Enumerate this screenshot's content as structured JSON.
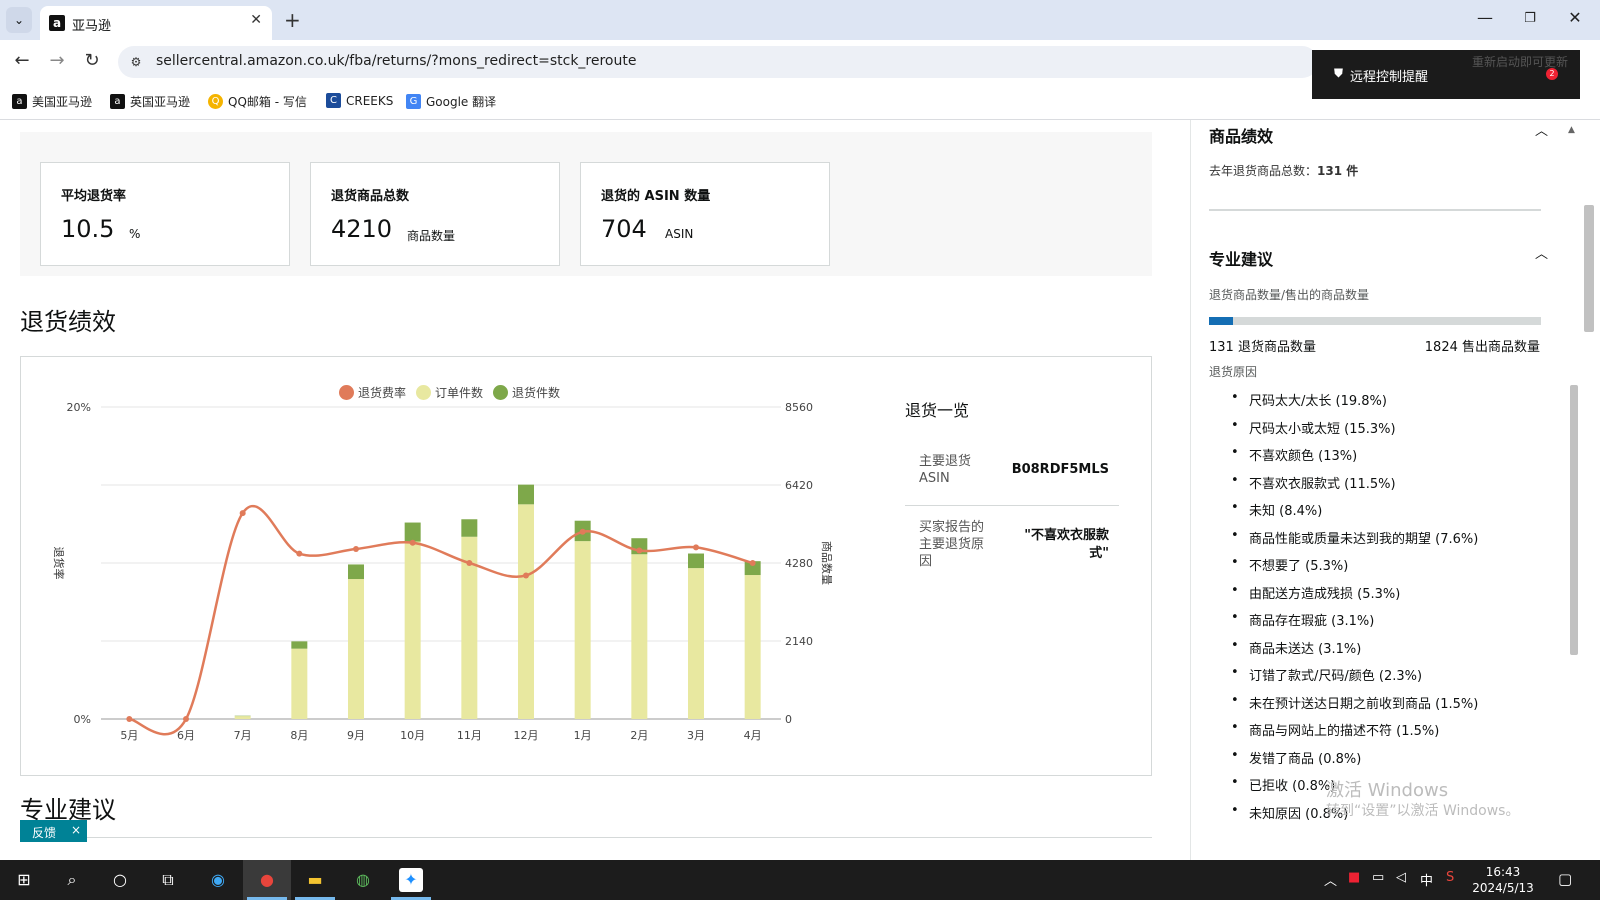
{
  "browser": {
    "tab_title": "亚马逊",
    "tab_favicon": "a",
    "url": "sellercentral.amazon.co.uk/fba/returns/?mons_redirect=stck_reroute",
    "bookmarks": [
      {
        "label": "美国亚马逊",
        "icon": "amazon-icon"
      },
      {
        "label": "英国亚马逊",
        "icon": "amazon-icon"
      },
      {
        "label": "QQ邮箱 - 写信",
        "icon": "qq-mail-icon"
      },
      {
        "label": "CREEKS",
        "icon": "creeks-icon"
      },
      {
        "label": "Google 翻译",
        "icon": "google-translate-icon"
      }
    ]
  },
  "remote_popup": {
    "label": "远程控制提醒",
    "badge": "2",
    "faint_text": "重新启动即可更新"
  },
  "metrics": [
    {
      "label": "平均退货率",
      "value": "10.5",
      "unit": "%"
    },
    {
      "label": "退货商品总数",
      "value": "4210",
      "unit": "商品数量"
    },
    {
      "label": "退货的 ASIN 数量",
      "value": "704",
      "unit": "ASIN"
    }
  ],
  "returns_section": {
    "title": "退货绩效"
  },
  "chart_data": {
    "type": "bar",
    "categories": [
      "5月",
      "6月",
      "7月",
      "8月",
      "9月",
      "10月",
      "11月",
      "12月",
      "1月",
      "2月",
      "3月",
      "4月"
    ],
    "series": [
      {
        "name": "退货费率",
        "type": "line",
        "axis": "left",
        "color": "#e07b5a",
        "values": [
          0,
          0,
          13.2,
          10.6,
          10.9,
          11.3,
          10.0,
          9.2,
          12.0,
          10.8,
          11.0,
          10.0
        ]
      },
      {
        "name": "订单件数",
        "type": "bar",
        "axis": "right",
        "color": "#e8e8a0",
        "values": [
          0,
          0,
          80,
          1930,
          3840,
          4870,
          5000,
          5890,
          4880,
          4520,
          4140,
          3950
        ]
      },
      {
        "name": "退货件数",
        "type": "bar",
        "axis": "right",
        "color": "#7ea84a",
        "values": [
          0,
          0,
          10,
          200,
          400,
          520,
          480,
          540,
          560,
          440,
          400,
          380
        ]
      }
    ],
    "left_axis": {
      "label": "退货率",
      "ticks": [
        "20%",
        "0%"
      ],
      "range": [
        0,
        20
      ]
    },
    "right_axis": {
      "label": "商品数量",
      "ticks": [
        "8560",
        "6420",
        "4280",
        "2140",
        "0"
      ],
      "range": [
        0,
        8560
      ]
    },
    "grid": true,
    "legend_position": "top-center"
  },
  "summary": {
    "title": "退货一览",
    "rows": [
      {
        "label": "主要退货 ASIN",
        "value": "B08RDF5MLS"
      },
      {
        "label": "买家报告的主要退货原因",
        "value": "\"不喜欢衣服款式\""
      }
    ]
  },
  "advice_section": {
    "title": "专业建议"
  },
  "feedback": {
    "label": "反馈",
    "close": "×"
  },
  "right_panel": {
    "product_performance": {
      "title": "商品绩效",
      "text_prefix": "去年退货商品总数：",
      "text_value": "131 件"
    },
    "pro_advice": {
      "title": "专业建议",
      "ratio_label": "退货商品数量/售出的商品数量",
      "progress": 0.072,
      "returned_label": "131 退货商品数量",
      "sold_label": "1824 售出商品数量",
      "reasons_label": "退货原因",
      "reasons": [
        "尺码太大/太长 (19.8%)",
        "尺码太小或太短 (15.3%)",
        "不喜欢颜色 (13%)",
        "不喜欢衣服款式 (11.5%)",
        "未知 (8.4%)",
        "商品性能或质量未达到我的期望 (7.6%)",
        "不想要了 (5.3%)",
        "由配送方造成残损 (5.3%)",
        "商品存在瑕疵 (3.1%)",
        "商品未送达 (3.1%)",
        "订错了款式/尺码/颜色 (2.3%)",
        "未在预计送达日期之前收到商品 (1.5%)",
        "商品与网站上的描述不符 (1.5%)",
        "发错了商品 (0.8%)",
        "已拒收 (0.8%)",
        "未知原因 (0.8%)"
      ]
    }
  },
  "watermark": {
    "line1": "激活 Windows",
    "line2": "转到“设置”以激活 Windows。"
  },
  "taskbar": {
    "time": "16:43",
    "date": "2024/5/13",
    "ime": "中"
  },
  "colors": {
    "accent_teal": "#008296",
    "progress_blue": "#146eb4",
    "rate_line": "#e07b5a"
  }
}
